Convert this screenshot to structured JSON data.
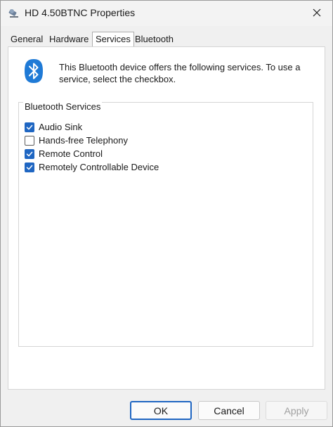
{
  "window": {
    "title": "HD 4.50BTNC Properties",
    "icon": "bluetooth-device-icon",
    "close_icon": "close-icon"
  },
  "tabs": [
    {
      "label": "General",
      "active": false
    },
    {
      "label": "Hardware",
      "active": false
    },
    {
      "label": "Services",
      "active": true
    },
    {
      "label": "Bluetooth",
      "active": false
    }
  ],
  "services_panel": {
    "icon": "bluetooth-icon",
    "description": "This Bluetooth device offers the following services. To use a service, select the checkbox.",
    "group_label": "Bluetooth Services",
    "services": [
      {
        "label": "Audio Sink",
        "checked": true
      },
      {
        "label": "Hands-free Telephony",
        "checked": false
      },
      {
        "label": "Remote Control",
        "checked": true
      },
      {
        "label": "Remotely Controllable Device",
        "checked": true
      }
    ]
  },
  "footer": {
    "ok_label": "OK",
    "cancel_label": "Cancel",
    "apply_label": "Apply",
    "apply_enabled": false
  },
  "colors": {
    "accent": "#1f66c2",
    "bluetooth_brand": "#1f7ad6"
  }
}
